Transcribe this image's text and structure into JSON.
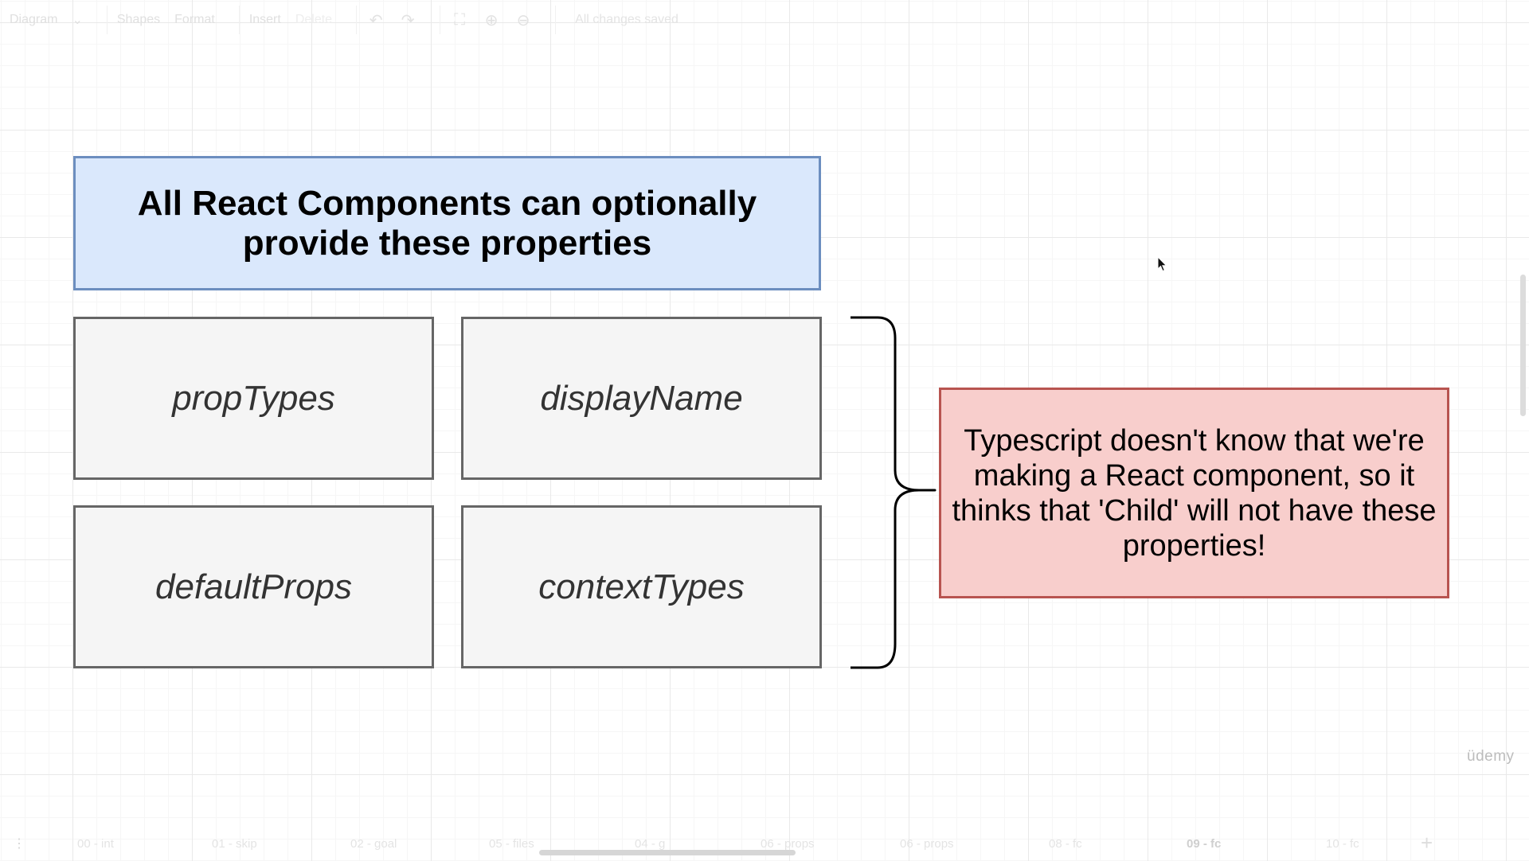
{
  "toolbar": {
    "diagram_menu": "Diagram",
    "shapes_menu": "Shapes",
    "format_menu": "Format",
    "insert_menu": "Insert",
    "delete_label": "Delete",
    "status": "All changes saved"
  },
  "diagram": {
    "title_line1": "All React Components can optionally",
    "title_line2": "provide these properties",
    "properties": [
      "propTypes",
      "displayName",
      "defaultProps",
      "contextTypes"
    ],
    "note": "Typescript doesn't know that we're making a React component, so it thinks that 'Child' will not have these properties!"
  },
  "watermark": "üdemy",
  "page_tabs": {
    "items": [
      "00 - int",
      "01 - skip",
      "02 - goal",
      "05 - files",
      "04 - g",
      "06 - props",
      "06 - props",
      "08 - fc",
      "09 - fc",
      "10 - fc"
    ],
    "active_index": 8,
    "add_label": "+"
  },
  "colors": {
    "title_fill": "#dae8fc",
    "title_stroke": "#6c8ebf",
    "prop_fill": "#f5f5f5",
    "prop_stroke": "#666666",
    "note_fill": "#f8cecc",
    "note_stroke": "#b85450"
  },
  "icons": [
    "undo-icon",
    "redo-icon",
    "fullscreen-icon",
    "zoom-in-icon",
    "zoom-out-icon",
    "cursor-icon",
    "brace-icon"
  ]
}
